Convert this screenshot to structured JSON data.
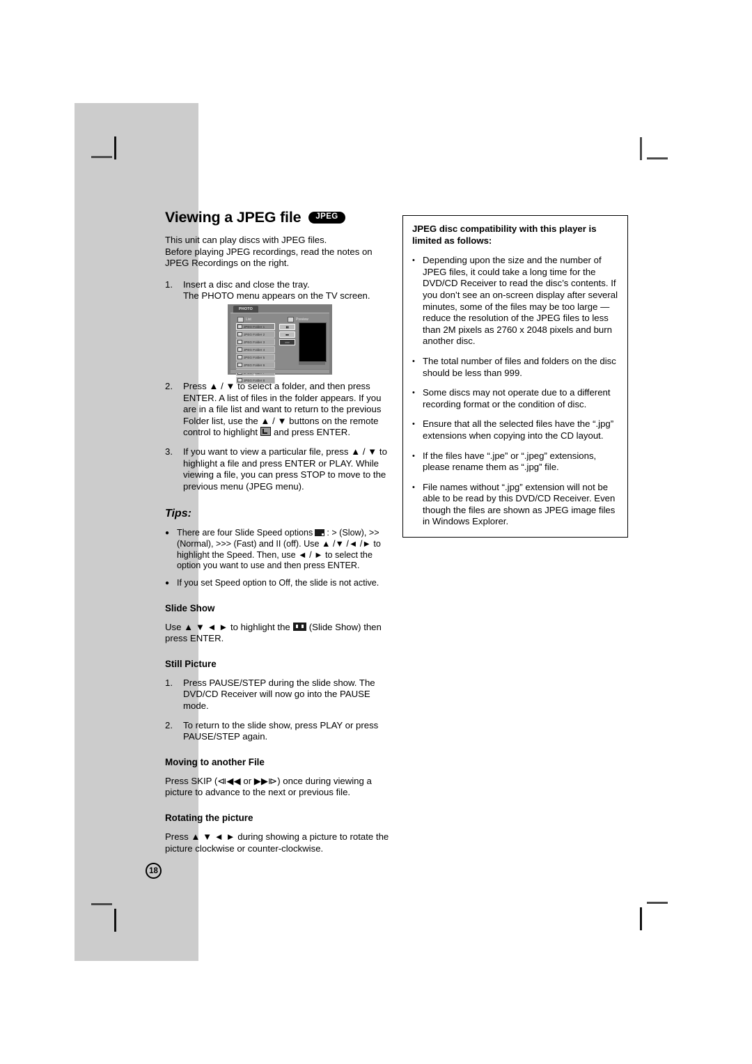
{
  "page": {
    "number": "18",
    "background_gray": "#cccccc"
  },
  "title": {
    "heading": "Viewing a JPEG file",
    "badge": "JPEG"
  },
  "left_column": {
    "intro": [
      "This unit can play discs with JPEG files.",
      "Before playing JPEG recordings, read the notes on",
      "JPEG Recordings on the right."
    ],
    "steps": [
      {
        "marker": "1.",
        "lines": [
          "Insert a disc and close the tray.",
          "The PHOTO menu appears on the TV screen."
        ]
      },
      {
        "marker": "2.",
        "text_before_icon": "Press ▲ / ▼ to select a folder, and then press ENTER. A list of files in the folder appears. If you are in a file list and want to return to the previous Folder list, use the ▲ / ▼ buttons on the remote control to highlight",
        "icon": "folder-back-icon",
        "text_after_icon": "and press ENTER."
      },
      {
        "marker": "3.",
        "text": "If you want to view a particular file, press ▲ / ▼ to highlight a file and press ENTER or PLAY. While viewing a file, you can press STOP to move to the previous menu (JPEG menu)."
      }
    ],
    "tips_heading": "Tips:",
    "tips": [
      {
        "text_before_icon": "There are four Slide Speed options",
        "icon": "slide-speed-icon",
        "text_after_icon": ": > (Slow), >> (Normal), >>> (Fast) and II (off). Use ▲ /▼ /◄ /► to highlight the Speed. Then, use ◄ / ► to select the option you want to use and then press ENTER."
      },
      {
        "text": "If you set Speed option to Off, the slide is not active."
      }
    ],
    "sections": [
      {
        "heading": "Slide Show",
        "type": "paragraph-with-icon",
        "text_before_icon": "Use ▲ ▼ ◄ ► to highlight the",
        "icon": "slide-show-icon",
        "text_after_icon": "(Slide Show) then press ENTER."
      },
      {
        "heading": "Still Picture",
        "type": "numbered",
        "items": [
          {
            "marker": "1.",
            "text": "Press PAUSE/STEP during the slide show. The DVD/CD Receiver will now go into the PAUSE mode."
          },
          {
            "marker": "2.",
            "text": "To return to the slide show, press PLAY or press PAUSE/STEP again."
          }
        ]
      },
      {
        "heading": "Moving to another File",
        "type": "paragraph",
        "text": "Press SKIP (⧏◀◀ or ▶▶⧐) once during viewing a picture to advance to the next or previous file."
      },
      {
        "heading": "Rotating the picture",
        "type": "paragraph",
        "text": "Press ▲ ▼ ◄ ►  during showing a picture to rotate the picture clockwise or counter-clockwise."
      }
    ]
  },
  "right_column": {
    "box_title": "JPEG disc compatibility with this player is limited as follows:",
    "bullets": [
      "Depending upon the size and the number of JPEG files, it could take a long time for the DVD/CD Receiver to read the disc’s contents. If you don’t see an on-screen display after several minutes, some of the files may be too large — reduce the resolution of the JPEG files to less than 2M pixels as 2760 x 2048 pixels and burn another disc.",
      "The total number of files and folders on the disc should be less than 999.",
      "Some discs may not operate due to a different recording format or the condition of disc.",
      "Ensure that all the selected files have the “.jpg” extensions when copying into the CD layout.",
      "If the files have “.jpe” or “.jpeg” extensions, please rename them as “.jpg” file.",
      "File names without “.jpg” extension will not be able to be read by this DVD/CD Receiver. Even though the files are shown as JPEG image files in Windows Explorer."
    ]
  },
  "tv_screenshot": {
    "tab_label": "PHOTO",
    "list_label": "List",
    "preview_label": "Preview",
    "files": [
      "JPEG Folder 1",
      "JPEG Folder 2",
      "JPEG Folder 3",
      "JPEG Folder 4",
      "JPEG Folder 5",
      "JPEG Folder 6",
      "JPEG Folder 7",
      "JPEG Folder 8"
    ],
    "scroll_arrow": "▼",
    "buttons": [
      "▮▮",
      "■■",
      ">>>"
    ]
  }
}
